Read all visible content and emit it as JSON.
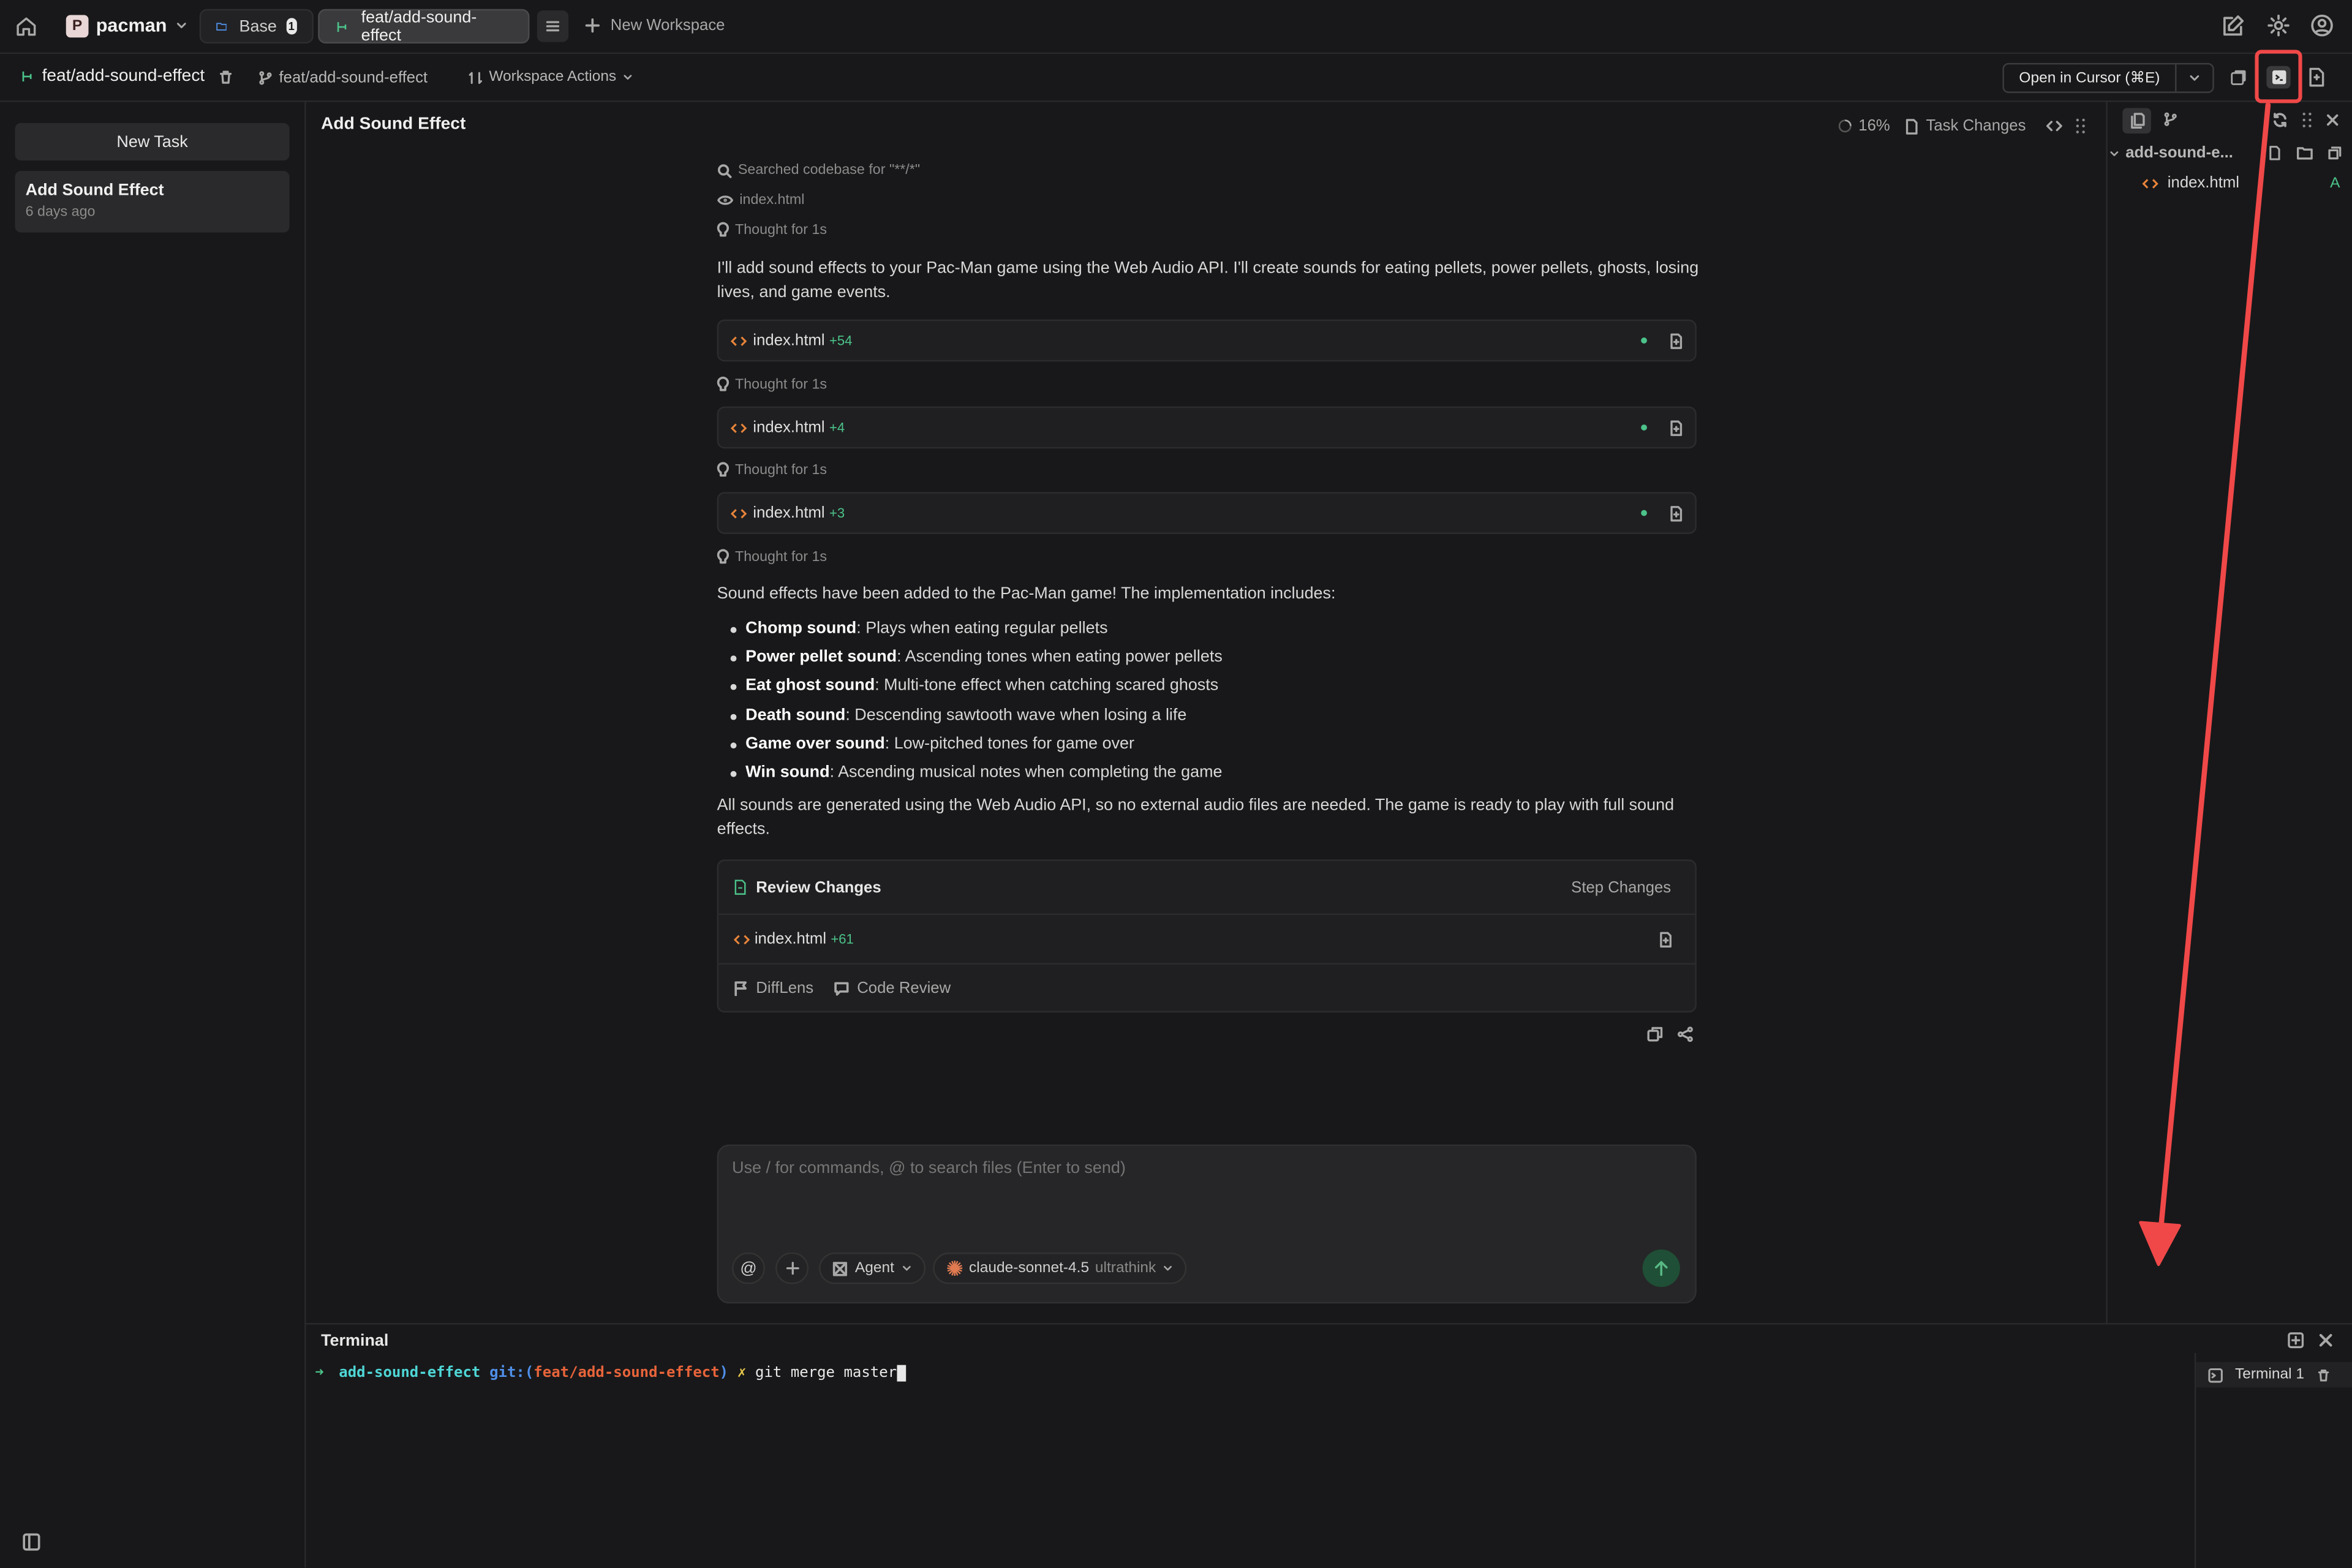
{
  "topbar": {
    "project_initial": "P",
    "project_name": "pacman",
    "tabs": [
      {
        "label": "Base",
        "badge": "1"
      },
      {
        "label": "feat/add-sound-effect"
      }
    ],
    "new_workspace": "New Workspace"
  },
  "subbar": {
    "workspace_name": "feat/add-sound-effect",
    "branch": "feat/add-sound-effect",
    "workspace_actions": "Workspace Actions",
    "open_in_cursor": "Open in Cursor (⌘E)"
  },
  "sidebar": {
    "new_task": "New Task",
    "tasks": [
      {
        "title": "Add Sound Effect",
        "time": "6 days ago"
      }
    ]
  },
  "main": {
    "title": "Add Sound Effect",
    "progress": "16%",
    "task_changes": "Task Changes",
    "search_meta": "Searched codebase for \"**/*\"",
    "view_meta": "index.html",
    "thought": "Thought for 1s",
    "intro": "I'll add sound effects to your Pac-Man game using the Web Audio API. I'll create sounds for eating pellets, power pellets, ghosts, losing lives, and game events.",
    "edits": [
      {
        "file": "index.html",
        "diff": "+54"
      },
      {
        "file": "index.html",
        "diff": "+4"
      },
      {
        "file": "index.html",
        "diff": "+3"
      }
    ],
    "summary_intro": "Sound effects have been added to the Pac-Man game! The implementation includes:",
    "features": [
      {
        "name": "Chomp sound",
        "desc": ": Plays when eating regular pellets"
      },
      {
        "name": "Power pellet sound",
        "desc": ": Ascending tones when eating power pellets"
      },
      {
        "name": "Eat ghost sound",
        "desc": ": Multi-tone effect when catching scared ghosts"
      },
      {
        "name": "Death sound",
        "desc": ": Descending sawtooth wave when losing a life"
      },
      {
        "name": "Game over sound",
        "desc": ": Low-pitched tones for game over"
      },
      {
        "name": "Win sound",
        "desc": ": Ascending musical notes when completing the game"
      }
    ],
    "closing": "All sounds are generated using the Web Audio API, so no external audio files are needed. The game is ready to play with full sound effects.",
    "review": {
      "title": "Review Changes",
      "step_changes": "Step Changes",
      "file": "index.html",
      "diff": "+61",
      "difflens": "DiffLens",
      "code_review": "Code Review"
    },
    "input": {
      "placeholder": "Use / for commands, @ to search files (Enter to send)",
      "agent": "Agent",
      "model": "claude-sonnet-4.5",
      "model_mode": "ultrathink"
    }
  },
  "right_panel": {
    "folder": "add-sound-e...",
    "file": "index.html",
    "file_status": "A"
  },
  "terminal": {
    "title": "Terminal",
    "prompt_arrow": "➜",
    "dir": "add-sound-effect",
    "git_prefix": "git:(",
    "git_branch": "feat/add-sound-effect",
    "git_suffix": ")",
    "dirty": "✗",
    "command": "git merge master",
    "tab_label": "Terminal 1"
  },
  "colors": {
    "annotation": "#f04848",
    "accent_green": "#4cc38a",
    "file_orange": "#e8843a"
  }
}
